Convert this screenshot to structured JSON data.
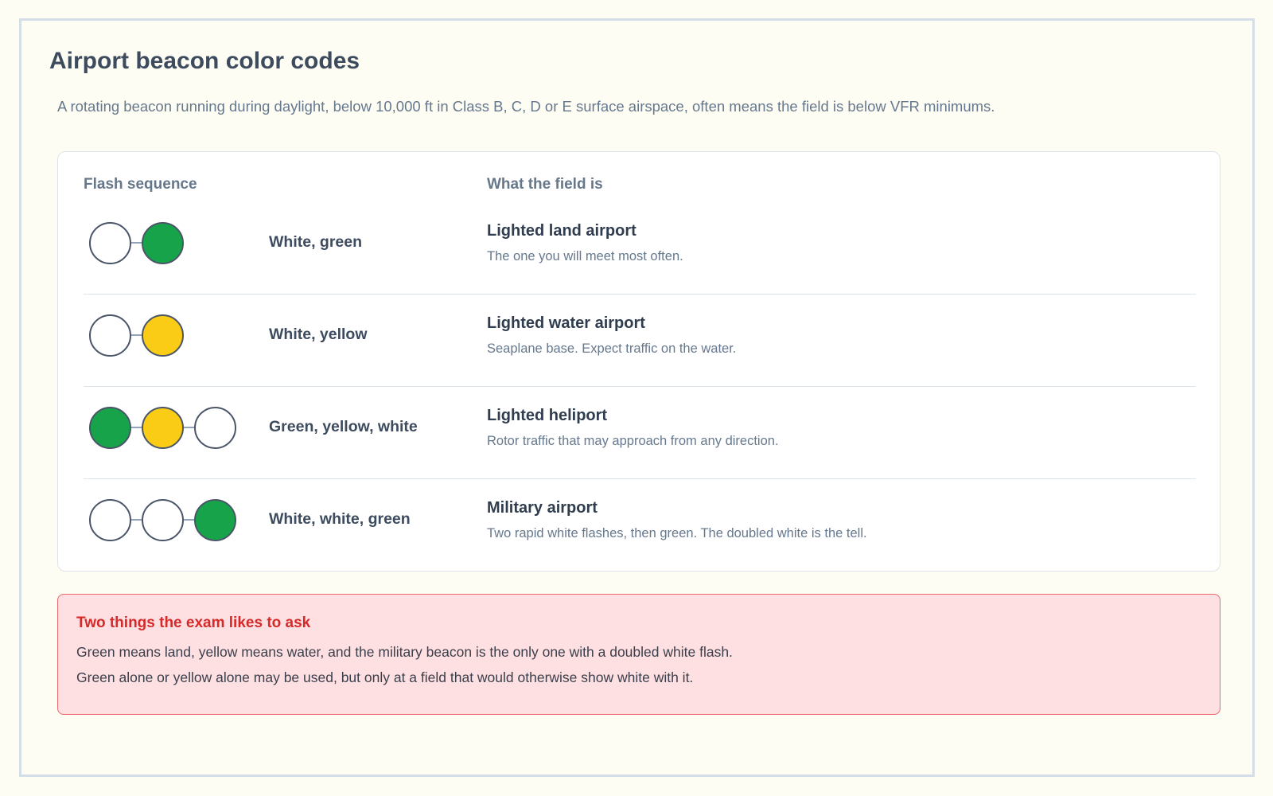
{
  "page": {
    "title": "Airport beacon color codes",
    "intro": "A rotating beacon running during daylight, below 10,000 ft in Class B, C, D or E surface airspace, often means the field is below VFR minimums."
  },
  "table": {
    "col_sequence": "Flash sequence",
    "col_field": "What the field is",
    "rows": [
      {
        "lights": [
          "white",
          "green"
        ],
        "sequence": "White, green",
        "field": "Lighted land airport",
        "description": "The one you will meet most often."
      },
      {
        "lights": [
          "white",
          "yellow"
        ],
        "sequence": "White, yellow",
        "field": "Lighted water airport",
        "description": "Seaplane base. Expect traffic on the water."
      },
      {
        "lights": [
          "green",
          "yellow",
          "white"
        ],
        "sequence": "Green, yellow, white",
        "field": "Lighted heliport",
        "description": "Rotor traffic that may approach from any direction."
      },
      {
        "lights": [
          "white",
          "white",
          "green"
        ],
        "sequence": "White, white, green",
        "field": "Military airport",
        "description": "Two rapid white flashes, then green. The doubled white is the tell."
      }
    ]
  },
  "callout": {
    "title": "Two things the exam likes to ask",
    "line1": "Green means land, yellow means water, and the military beacon is the only one with a doubled white flash.",
    "line2": "Green alone or yellow alone may be used, but only at a field that would otherwise show white with it."
  },
  "colors": {
    "white": "#ffffff",
    "green": "#16a34a",
    "yellow": "#facc15",
    "alert_red": "#d52a2a"
  }
}
